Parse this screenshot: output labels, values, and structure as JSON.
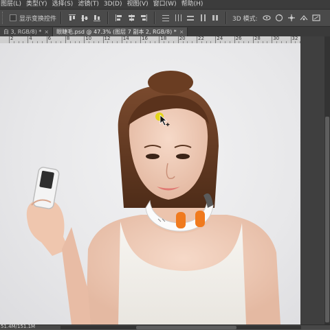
{
  "menu": [
    "图层(L)",
    "类型(Y)",
    "选择(S)",
    "滤镜(T)",
    "3D(D)",
    "视图(V)",
    "窗口(W)",
    "帮助(H)"
  ],
  "options": {
    "show_transform_label": "显示变换控件",
    "mode_label": "3D 模式:"
  },
  "tabs": [
    {
      "label": "白 3, RGB/8) *",
      "close": "×",
      "active": false
    },
    {
      "label": "眼睫毛.psd @ 47.3% (图层 7 副本 2, RGB/8) *",
      "close": "×",
      "active": true
    }
  ],
  "ruler": {
    "labels": [
      "2",
      "4",
      "6",
      "8",
      "10",
      "12",
      "14",
      "16",
      "18",
      "20",
      "22",
      "24",
      "26",
      "28",
      "30",
      "32"
    ]
  },
  "status": {
    "doc_size": "51.4M/151.1M"
  },
  "colors": {
    "device_accent": "#f07a1e",
    "menubar_bg": "#3c3c3c",
    "canvas_bg": "#e9e9eb"
  },
  "icons": [
    "checkbox-icon",
    "align-top-icon",
    "align-vcenter-icon",
    "align-bottom-icon",
    "align-left-icon",
    "align-hcenter-icon",
    "align-right-icon",
    "distribute-icon",
    "rotate-3d-icon",
    "roll-3d-icon",
    "drag-3d-icon",
    "slide-3d-icon",
    "scale-3d-icon",
    "move-cursor-icon"
  ]
}
